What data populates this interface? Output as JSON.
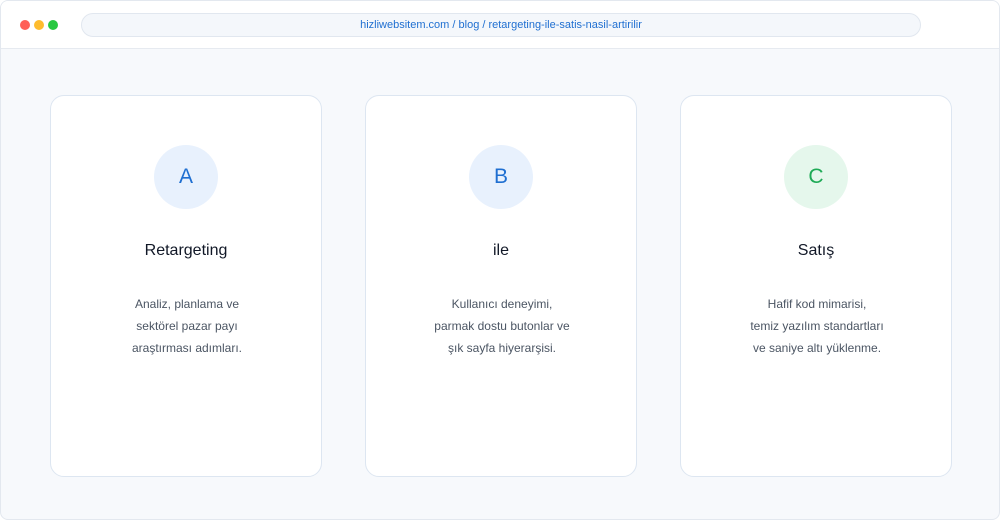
{
  "browser": {
    "url": "hizliwebsitem.com / blog / retargeting-ile-satis-nasil-artirilir"
  },
  "colors": {
    "accent_blue": "#1f6fd1",
    "accent_green": "#1eaa56",
    "badge_blue_bg": "#e8f1fd",
    "badge_green_bg": "#e5f7ec"
  },
  "cards": [
    {
      "letter": "A",
      "title": "Retargeting",
      "lines": [
        "Analiz, planlama ve",
        "sektörel pazar payı",
        "araştırması adımları."
      ]
    },
    {
      "letter": "B",
      "title": "ile",
      "lines": [
        "Kullanıcı deneyimi,",
        "parmak dostu butonlar ve",
        "şık sayfa hiyerarşisi."
      ]
    },
    {
      "letter": "C",
      "title": "Satış",
      "lines": [
        "Hafif kod mimarisi,",
        "temiz yazılım standartları",
        "ve saniye altı yüklenme."
      ]
    }
  ]
}
